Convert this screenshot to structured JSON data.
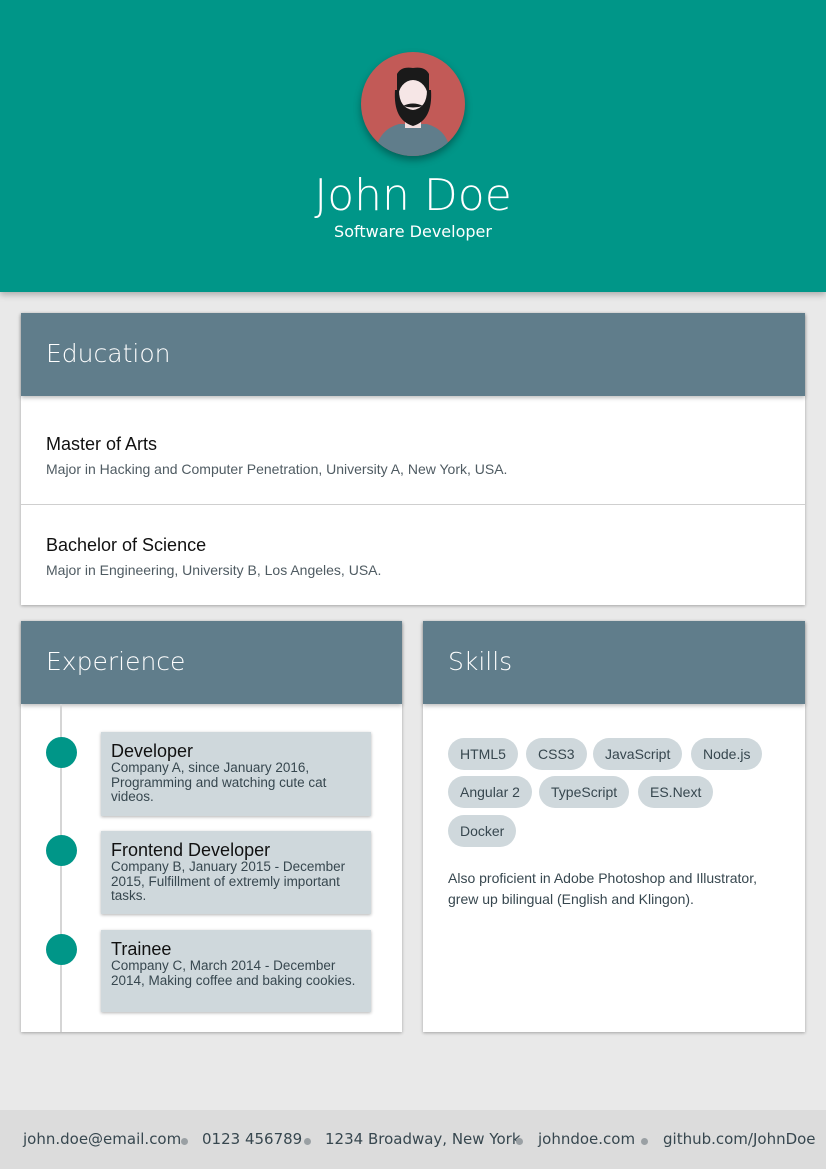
{
  "header": {
    "name": "John Doe",
    "title": "Software Developer",
    "avatar_icon": "bearded-man-avatar-icon"
  },
  "education": {
    "heading": "Education",
    "items": [
      {
        "title": "Master of Arts",
        "description": "Major in Hacking and Computer Penetration, University A, New York, USA."
      },
      {
        "title": "Bachelor of Science",
        "description": "Major in Engineering, University B, Los Angeles, USA."
      }
    ]
  },
  "experience": {
    "heading": "Experience",
    "items": [
      {
        "title": "Developer",
        "description": "Company A, since January 2016, Programming and watching cute cat videos."
      },
      {
        "title": "Frontend Developer",
        "description": "Company B, January 2015 - December 2015, Fulfillment of extremly important tasks."
      },
      {
        "title": "Trainee",
        "description": "Company C, March 2014 - December 2014, Making coffee and baking cookies."
      }
    ]
  },
  "skills": {
    "heading": "Skills",
    "chips": [
      "HTML5",
      "CSS3",
      "JavaScript",
      "Node.js",
      "Angular 2",
      "TypeScript",
      "ES.Next",
      "Docker"
    ],
    "note": "Also proficient in Adobe Photoshop and Illustrator, grew up bilingual (English and Klingon)."
  },
  "footer": {
    "email": "john.doe@email.com",
    "phone": "0123 456789",
    "address": "1234 Broadway, New York",
    "website": "johndoe.com",
    "github": "github.com/JohnDoe"
  },
  "colors": {
    "primary": "#009688",
    "section_header": "#607d8b",
    "chip": "#cfd8dc",
    "avatar_bg": "#c25a57"
  }
}
